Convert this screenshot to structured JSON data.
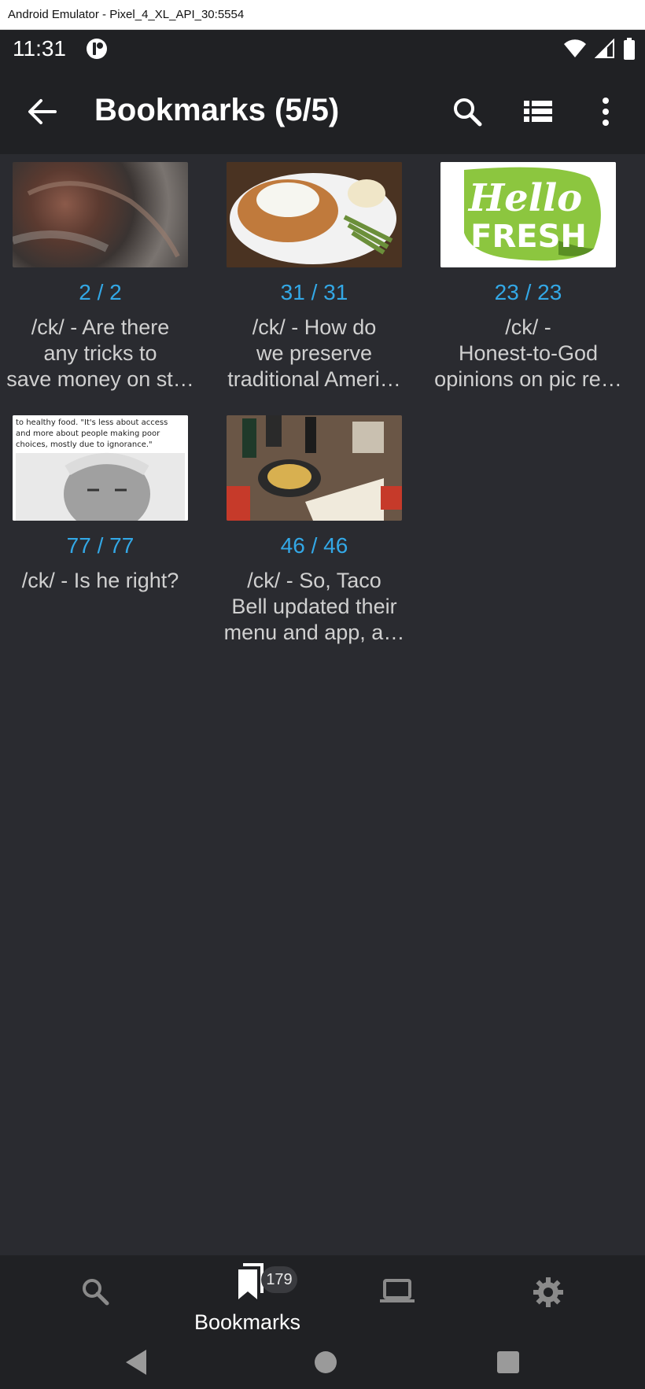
{
  "window": {
    "title": "Android Emulator - Pixel_4_XL_API_30:5554"
  },
  "status_bar": {
    "time": "11:31"
  },
  "appbar": {
    "title": "Bookmarks (5/5)"
  },
  "bookmarks": [
    {
      "count": "2 / 2",
      "lines": [
        "/ck/ - Are there",
        "any tricks to",
        "save money on st…"
      ]
    },
    {
      "count": "31 / 31",
      "lines": [
        "/ck/ - How do",
        "we preserve",
        "traditional Ameri…"
      ]
    },
    {
      "count": "23 / 23",
      "lines": [
        "/ck/ -",
        "Honest-to-God",
        "opinions on pic re…"
      ]
    },
    {
      "count": "77 / 77",
      "lines": [
        "/ck/ - Is he right?"
      ],
      "thumb_text": [
        "to healthy food. \"It's less about access",
        "and more about people making poor",
        "choices, mostly due to ignorance.\""
      ]
    },
    {
      "count": "46 / 46",
      "lines": [
        "/ck/ - So, Taco",
        "Bell updated their",
        "menu and app, a…"
      ]
    }
  ],
  "logo_text": {
    "line1": "Hello",
    "line2": "FRESH"
  },
  "bottom_nav": {
    "items": [
      {
        "icon": "search-icon",
        "label": ""
      },
      {
        "icon": "bookmarks-icon",
        "label": "Bookmarks",
        "badge": "179"
      },
      {
        "icon": "laptop-icon",
        "label": ""
      },
      {
        "icon": "gear-icon",
        "label": ""
      }
    ]
  },
  "colors": {
    "background": "#2a2b30",
    "bars": "#202124",
    "accent": "#33a8e6",
    "text": "#d0d0d0"
  }
}
